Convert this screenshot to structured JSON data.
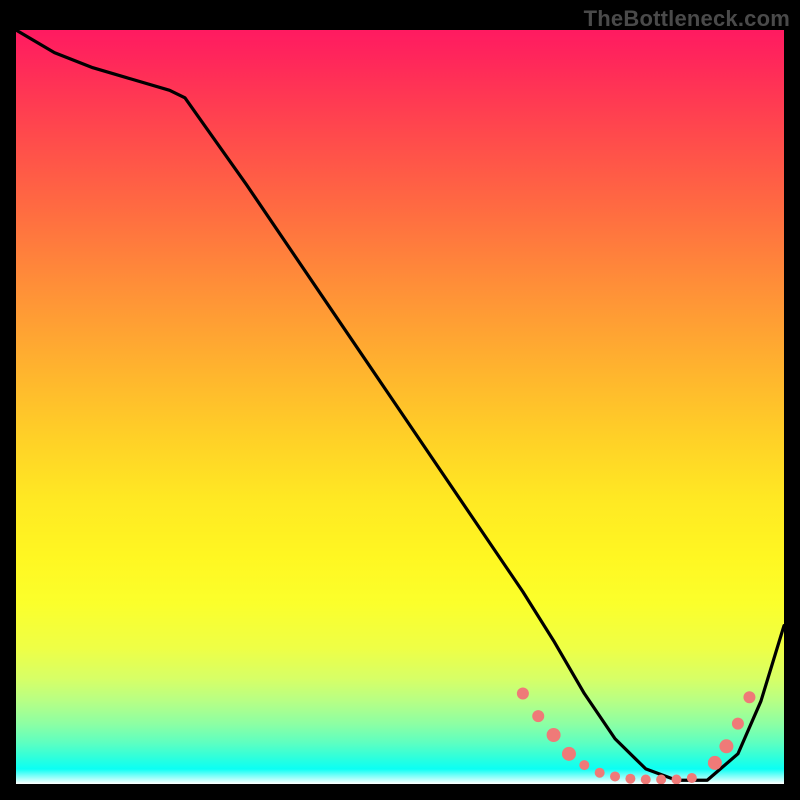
{
  "watermark": "TheBottleneck.com",
  "chart_data": {
    "type": "line",
    "title": "",
    "xlabel": "",
    "ylabel": "",
    "xlim": [
      0,
      100
    ],
    "ylim": [
      0,
      100
    ],
    "series": [
      {
        "name": "curve",
        "x": [
          0,
          5,
          10,
          15,
          20,
          22,
          30,
          40,
          50,
          60,
          66,
          70,
          74,
          78,
          82,
          86,
          90,
          94,
          97,
          100
        ],
        "y": [
          100,
          97,
          95,
          93.5,
          92,
          91,
          79.5,
          64.5,
          49.5,
          34.5,
          25.5,
          19,
          12,
          6,
          2,
          0.5,
          0.5,
          4,
          11,
          21
        ]
      }
    ],
    "markers": {
      "name": "dots",
      "color": "#ef7a78",
      "points": [
        {
          "x": 66,
          "y": 12.0,
          "r": 6
        },
        {
          "x": 68,
          "y": 9.0,
          "r": 6
        },
        {
          "x": 70,
          "y": 6.5,
          "r": 7
        },
        {
          "x": 72,
          "y": 4.0,
          "r": 7
        },
        {
          "x": 74,
          "y": 2.5,
          "r": 5
        },
        {
          "x": 76,
          "y": 1.5,
          "r": 5
        },
        {
          "x": 78,
          "y": 1.0,
          "r": 5
        },
        {
          "x": 80,
          "y": 0.7,
          "r": 5
        },
        {
          "x": 82,
          "y": 0.6,
          "r": 5
        },
        {
          "x": 84,
          "y": 0.6,
          "r": 5
        },
        {
          "x": 86,
          "y": 0.6,
          "r": 5
        },
        {
          "x": 88,
          "y": 0.8,
          "r": 5
        },
        {
          "x": 91,
          "y": 2.8,
          "r": 7
        },
        {
          "x": 92.5,
          "y": 5.0,
          "r": 7
        },
        {
          "x": 94,
          "y": 8.0,
          "r": 6
        },
        {
          "x": 95.5,
          "y": 11.5,
          "r": 6
        }
      ]
    },
    "gradient_stops": [
      {
        "pos": 0.0,
        "color": "#ff1a61"
      },
      {
        "pos": 0.5,
        "color": "#ffd027"
      },
      {
        "pos": 0.8,
        "color": "#f4ff30"
      },
      {
        "pos": 0.95,
        "color": "#3bffcf"
      },
      {
        "pos": 1.0,
        "color": "#ffffff"
      }
    ]
  }
}
